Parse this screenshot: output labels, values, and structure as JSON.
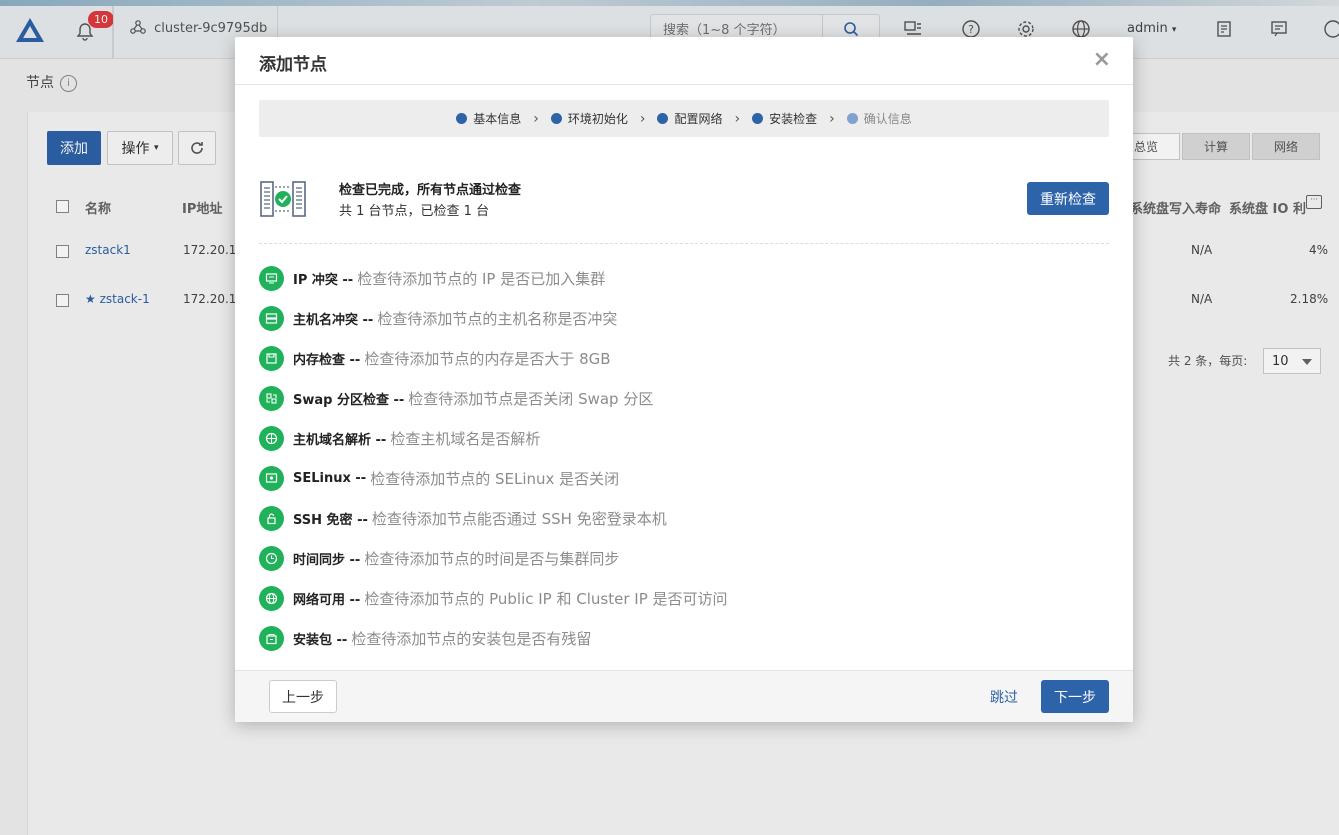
{
  "topbar": {
    "notification_count": "10",
    "cluster_name": "cluster-9c9795db",
    "search_placeholder": "搜索（1~8 个字符）",
    "user": "admin"
  },
  "page": {
    "title": "节点",
    "toolbar": {
      "add": "添加",
      "operation": "操作"
    },
    "columns": [
      "名称",
      "IP地址"
    ],
    "right_columns": [
      "系统盘写入寿命",
      "系统盘 IO 利"
    ],
    "rows": [
      {
        "name": "zstack1",
        "ip": "172.20.1",
        "life": "N/A",
        "io": "4%"
      },
      {
        "name": "zstack-1",
        "ip": "172.20.1",
        "life": "N/A",
        "io": "2.18%"
      }
    ],
    "tabs": [
      "总览",
      "计算",
      "网络"
    ],
    "pager_text": "共 2 条，每页:",
    "page_size": "10"
  },
  "modal": {
    "title": "添加节点",
    "steps": [
      {
        "label": "基本信息",
        "done": true
      },
      {
        "label": "环境初始化",
        "done": true
      },
      {
        "label": "配置网络",
        "done": true
      },
      {
        "label": "安装检查",
        "done": true
      },
      {
        "label": "确认信息",
        "done": false
      }
    ],
    "summary": {
      "title": "检查已完成，所有节点通过检查",
      "subtitle": "共 1 台节点，已检查 1 台",
      "recheck": "重新检查"
    },
    "checks": [
      {
        "name": "IP 冲突 --",
        "desc": "检查待添加节点的 IP 是否已加入集群",
        "icon": "monitor-icon"
      },
      {
        "name": "主机名冲突 --",
        "desc": "检查待添加节点的主机名称是否冲突",
        "icon": "server-icon"
      },
      {
        "name": "内存检查 --",
        "desc": "检查待添加节点的内存是否大于 8GB",
        "icon": "memory-icon"
      },
      {
        "name": "Swap 分区检查 --",
        "desc": "检查待添加节点是否关闭 Swap 分区",
        "icon": "partition-icon"
      },
      {
        "name": "主机域名解析 --",
        "desc": "检查主机域名是否解析",
        "icon": "globe-icon"
      },
      {
        "name": "SELinux --",
        "desc": "检查待添加节点的 SELinux 是否关闭",
        "icon": "shield-screen-icon"
      },
      {
        "name": "SSH 免密 --",
        "desc": "检查待添加节点能否通过 SSH 免密登录本机",
        "icon": "lock-icon"
      },
      {
        "name": "时间同步 --",
        "desc": "检查待添加节点的时间是否与集群同步",
        "icon": "clock-icon"
      },
      {
        "name": "网络可用 --",
        "desc": "检查待添加节点的 Public IP 和 Cluster IP 是否可访问",
        "icon": "network-icon"
      },
      {
        "name": "安装包 --",
        "desc": "检查待添加节点的安装包是否有残留",
        "icon": "package-icon"
      }
    ],
    "footer": {
      "prev": "上一步",
      "skip": "跳过",
      "next": "下一步"
    }
  },
  "colors": {
    "primary": "#2d63a8",
    "success": "#1fb25a",
    "badge": "#e0393e"
  }
}
